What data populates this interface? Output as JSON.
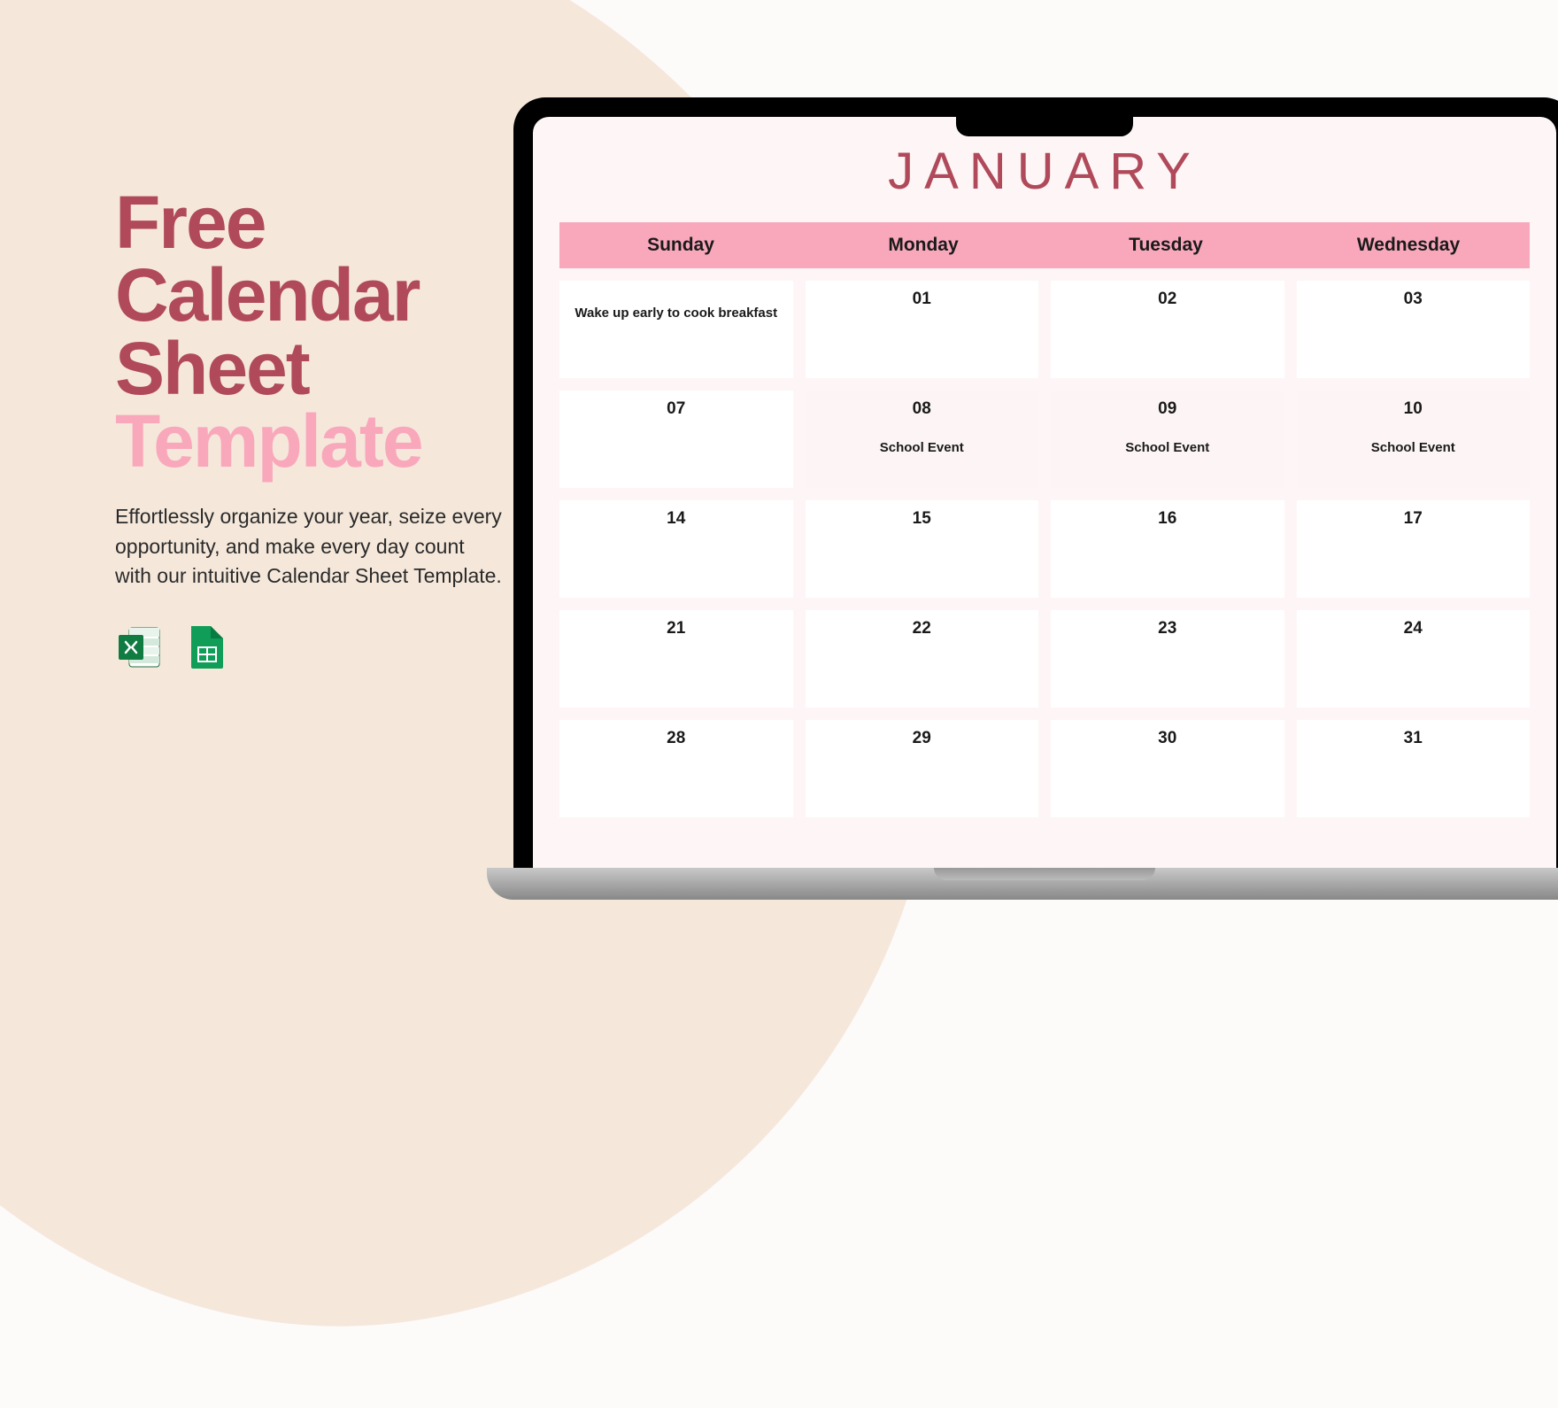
{
  "promo": {
    "title_lines": [
      "Free",
      "Calendar",
      "Sheet",
      "Template"
    ],
    "description": "Effortlessly organize your year, seize every opportunity, and make every day count with our intuitive Calendar Sheet Template.",
    "icons": [
      "excel-icon",
      "google-sheets-icon"
    ]
  },
  "calendar": {
    "month": "JANUARY",
    "weekdays": [
      "Sunday",
      "Monday",
      "Tuesday",
      "Wednesday"
    ],
    "weeks": [
      [
        {
          "num": "",
          "event": "Wake up early to cook breakfast",
          "tinted": false
        },
        {
          "num": "01",
          "event": "",
          "tinted": false
        },
        {
          "num": "02",
          "event": "",
          "tinted": false
        },
        {
          "num": "03",
          "event": "",
          "tinted": false
        }
      ],
      [
        {
          "num": "07",
          "event": "",
          "tinted": false
        },
        {
          "num": "08",
          "event": "School Event",
          "tinted": true
        },
        {
          "num": "09",
          "event": "School Event",
          "tinted": true
        },
        {
          "num": "10",
          "event": "School Event",
          "tinted": true
        }
      ],
      [
        {
          "num": "14",
          "event": "",
          "tinted": false
        },
        {
          "num": "15",
          "event": "",
          "tinted": false
        },
        {
          "num": "16",
          "event": "",
          "tinted": false
        },
        {
          "num": "17",
          "event": "",
          "tinted": false
        }
      ],
      [
        {
          "num": "21",
          "event": "",
          "tinted": false
        },
        {
          "num": "22",
          "event": "",
          "tinted": false
        },
        {
          "num": "23",
          "event": "",
          "tinted": false
        },
        {
          "num": "24",
          "event": "",
          "tinted": false
        }
      ],
      [
        {
          "num": "28",
          "event": "",
          "tinted": false
        },
        {
          "num": "29",
          "event": "",
          "tinted": false
        },
        {
          "num": "30",
          "event": "",
          "tinted": false
        },
        {
          "num": "31",
          "event": "",
          "tinted": false
        }
      ]
    ]
  }
}
